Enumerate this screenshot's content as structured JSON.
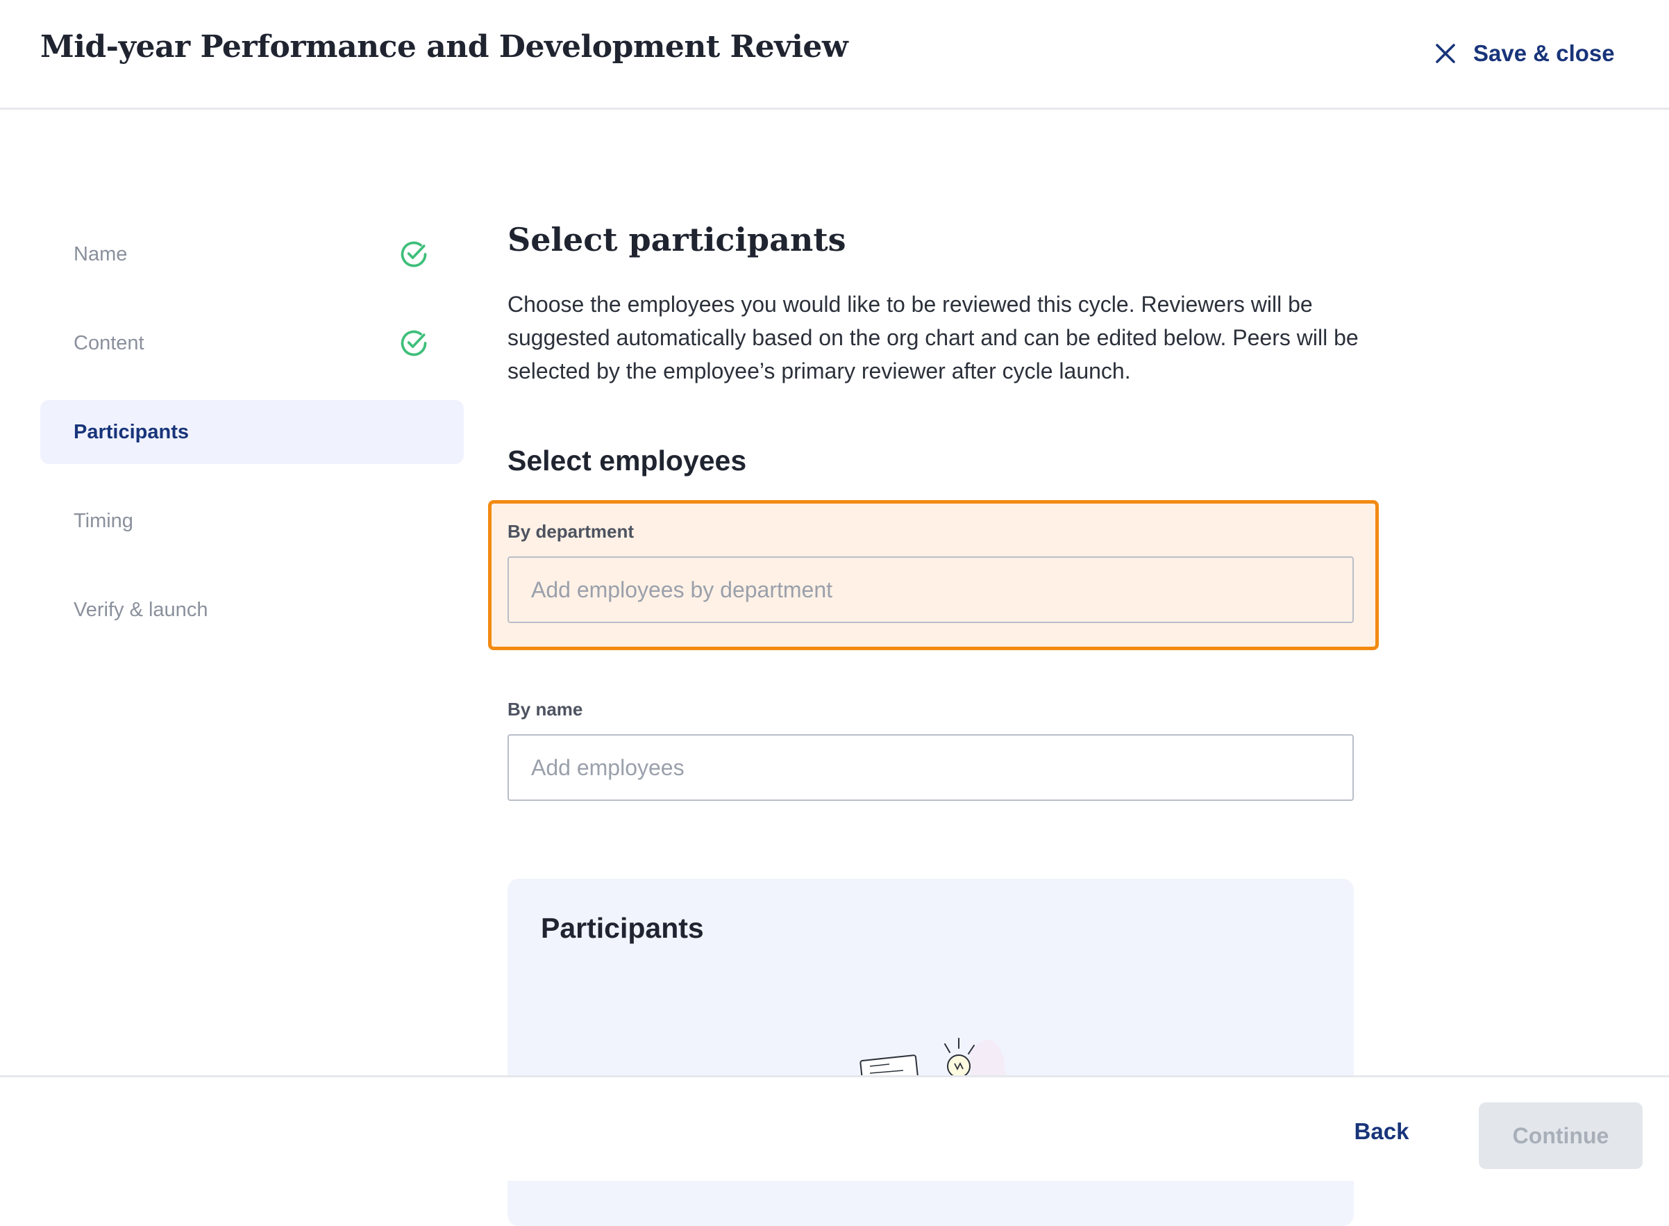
{
  "header": {
    "title": "Mid-year Performance and Development Review",
    "save_close_label": "Save & close",
    "close_icon": "close-icon"
  },
  "sidebar": {
    "steps": [
      {
        "label": "Name",
        "status": "complete",
        "icon": "check-circle-icon"
      },
      {
        "label": "Content",
        "status": "complete",
        "icon": "check-circle-icon"
      },
      {
        "label": "Participants",
        "status": "active"
      },
      {
        "label": "Timing",
        "status": "upcoming"
      },
      {
        "label": "Verify & launch",
        "status": "upcoming"
      }
    ]
  },
  "main": {
    "title": "Select participants",
    "description": "Choose the employees you would like to be reviewed this cycle. Reviewers will be suggested automatically based on the org chart and can be edited below. Peers will be selected by the employee’s primary reviewer after cycle launch.",
    "select_employees_title": "Select employees",
    "by_department": {
      "label": "By department",
      "placeholder": "Add employees by department",
      "value": ""
    },
    "by_name": {
      "label": "By name",
      "placeholder": "Add employees",
      "value": ""
    },
    "participants_card": {
      "title": "Participants",
      "illustration": "empty-state-illustration"
    }
  },
  "footer": {
    "back_label": "Back",
    "continue_label": "Continue",
    "continue_disabled": true
  },
  "colors": {
    "accent": "#18347a",
    "check": "#3dbf7a",
    "highlight_border": "#f28a12",
    "highlight_fill": "#fff1e6",
    "active_step_bg": "#f0f3fd"
  }
}
